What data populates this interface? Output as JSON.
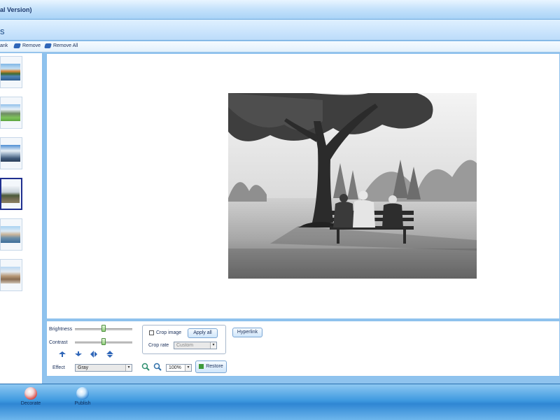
{
  "window": {
    "title": "al Version)"
  },
  "header": {
    "title": "s"
  },
  "toolbar": {
    "items": [
      {
        "label": "ank",
        "icon": "blank-icon"
      },
      {
        "label": "Remove",
        "icon": "remove-icon"
      },
      {
        "label": "Remove All",
        "icon": "remove-all-icon"
      }
    ]
  },
  "sidebar": {
    "thumbnails": [
      {
        "name": "autumn-lake",
        "selected": false
      },
      {
        "name": "alpine-valley",
        "selected": false
      },
      {
        "name": "snowy-mountains",
        "selected": false
      },
      {
        "name": "park-bench",
        "selected": true
      },
      {
        "name": "coastal-town",
        "selected": false
      },
      {
        "name": "old-town",
        "selected": false
      }
    ]
  },
  "controls": {
    "brightness_label": "Brightness",
    "brightness_value": 0.5,
    "contrast_label": "Contrast",
    "contrast_value": 0.5,
    "effect_label": "Effect",
    "effect_value": "Gray",
    "crop_image_label": "Crop image",
    "crop_image_checked": false,
    "apply_all_label": "Apply all",
    "crop_rate_label": "Crop rate",
    "crop_rate_value": "Custom",
    "zoom_value": "100%",
    "restore_label": "Restore",
    "hyperlink_label": "Hyperlink"
  },
  "bottom_nav": [
    {
      "label": "Decorate",
      "icon": "decorate-icon"
    },
    {
      "label": "Publish",
      "icon": "publish-icon"
    }
  ],
  "colors": {
    "accent": "#2f86d3",
    "selected_border": "#1f2f8f"
  }
}
